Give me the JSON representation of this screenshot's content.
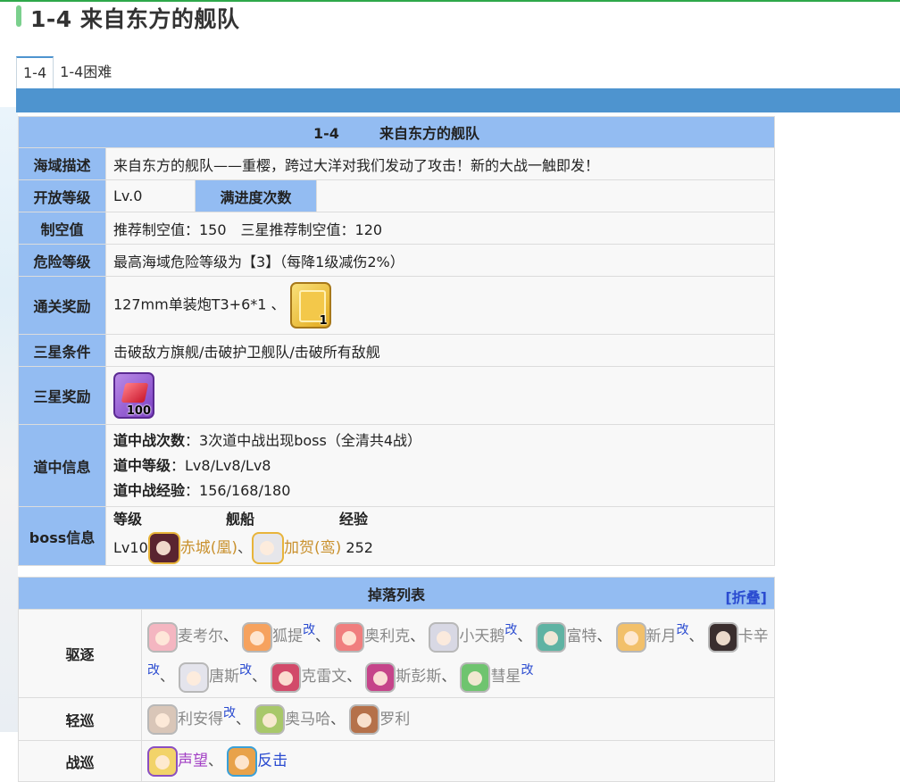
{
  "page": {
    "title": "1-4 来自东方的舰队"
  },
  "tabs": [
    {
      "label": "1-4"
    },
    {
      "label": "1-4困难"
    }
  ],
  "info": {
    "stage_id": "1-4",
    "stage_name": "来自东方的舰队",
    "desc_label": "海域描述",
    "desc": "来自东方的舰队——重樱，跨过大洋对我们发动了攻击！新的大战一触即发！",
    "level_label": "开放等级",
    "level": "Lv.0",
    "clear_label": "满进度次数",
    "air_label": "制空值",
    "air": "推荐制空值：150　三星推荐制空值：120",
    "danger_label": "危险等级",
    "danger": "最高海域危险等级为【3】（每降1级减伤2%）",
    "reward_label": "通关奖励",
    "reward_text": "127mm单装炮T3+6*1 、",
    "reward_qty": "1",
    "star_cond_label": "三星条件",
    "star_cond": "击破敌方旗舰/击破护卫舰队/击破所有敌舰",
    "star_reward_label": "三星奖励",
    "star_reward_qty": "100",
    "route_label": "道中信息",
    "route_battles_label": "道中战次数",
    "route_battles": "：3次道中战出现boss（全清共4战）",
    "route_level_label": "道中等级",
    "route_level": "：Lv8/Lv8/Lv8",
    "route_exp_label": "道中战经验",
    "route_exp": "：156/168/180",
    "boss_label": "boss信息",
    "boss_col_level": "等级",
    "boss_col_ship": "舰船",
    "boss_col_exp": "经验",
    "boss_level": "Lv10",
    "boss_ship1": "赤城(凰)",
    "boss_sep": "、",
    "boss_ship2": "加贺(鸾)",
    "boss_exp": "252"
  },
  "drops": {
    "title": "掉落列表",
    "collapse": "[折叠]",
    "kai": "改",
    "sep": "、",
    "rows": [
      {
        "label": "驱逐"
      },
      {
        "label": "轻巡"
      },
      {
        "label": "战巡"
      }
    ],
    "dd": [
      "麦考尔",
      "狐提",
      "奥利克",
      "小天鹅",
      "富特",
      "新月",
      "卡辛",
      "唐斯",
      "克雷文",
      "斯彭斯",
      "彗星"
    ],
    "cl": [
      "利安得",
      "奥马哈",
      "罗利"
    ],
    "bc": [
      "声望",
      "反击"
    ]
  },
  "colors": {
    "header_blue": "#93bcf2",
    "band_blue": "#4e94cf",
    "accent_green": "#7bd08d"
  }
}
